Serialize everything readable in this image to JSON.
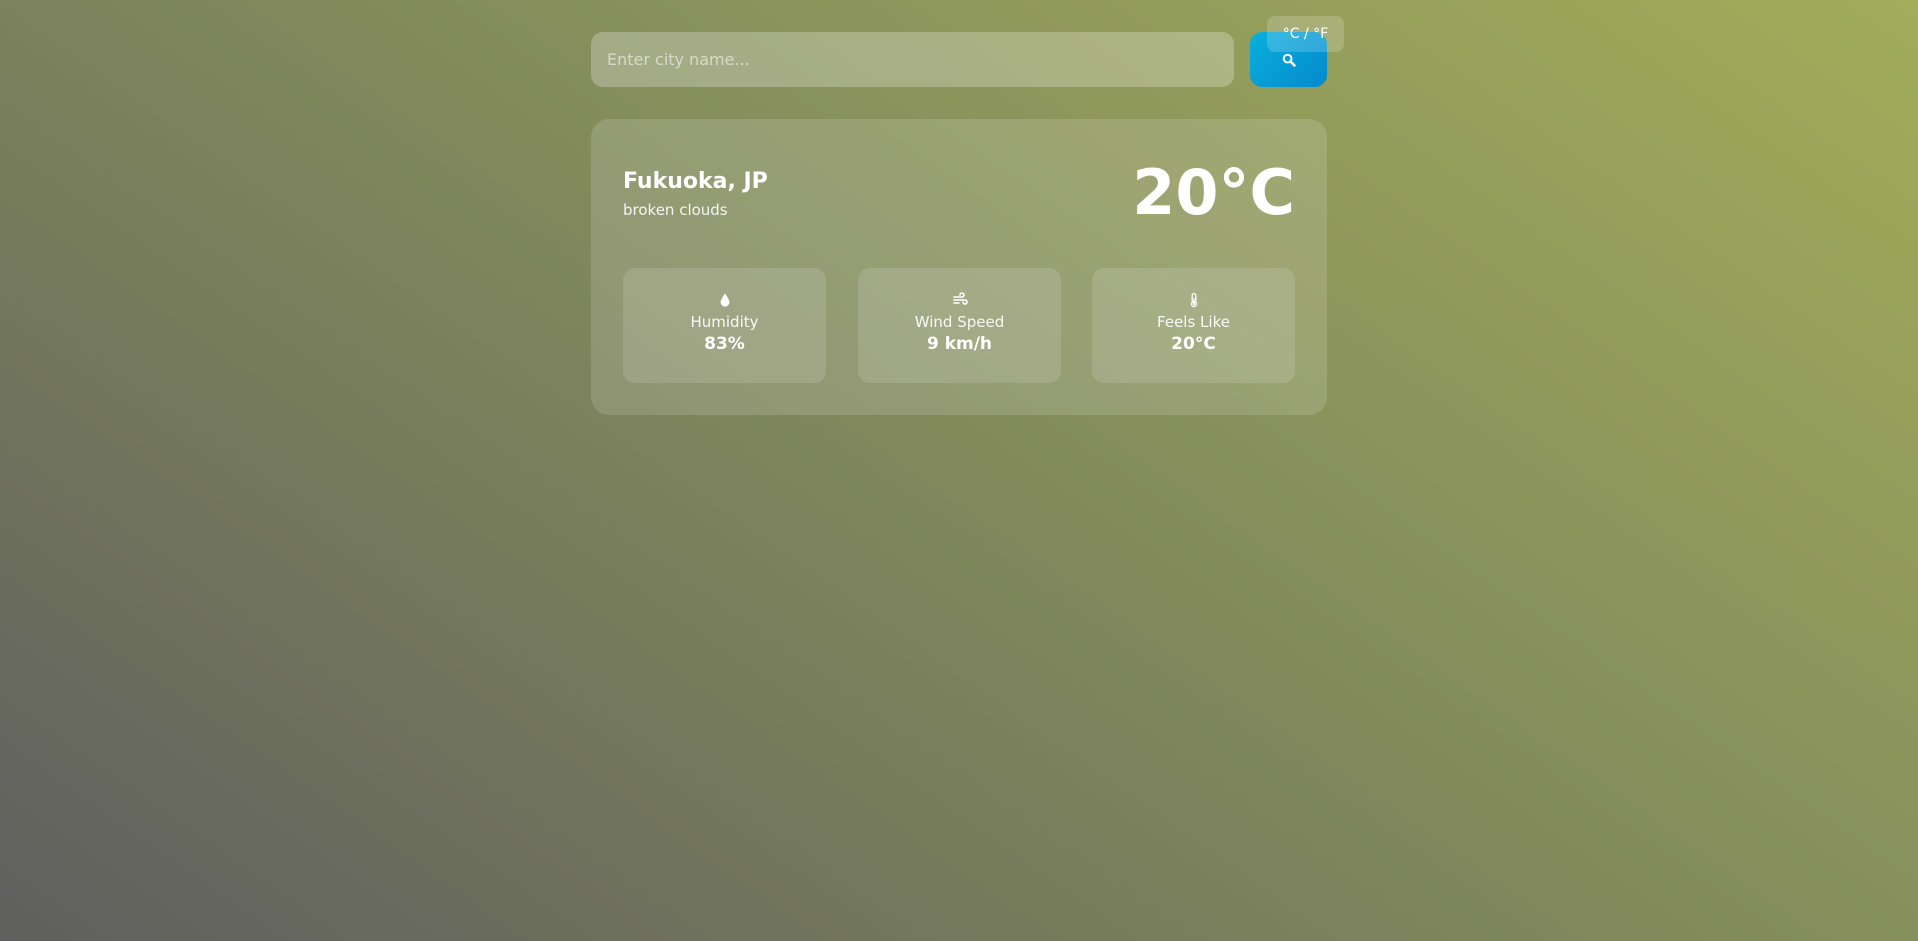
{
  "search": {
    "placeholder": "Enter city name...",
    "value": "",
    "button_icon": "search-icon"
  },
  "unit_toggle": {
    "label": "°C / °F"
  },
  "weather": {
    "city": "Fukuoka, JP",
    "condition": "broken clouds",
    "temperature": "20°C"
  },
  "stats": [
    {
      "icon": "water-drop-icon",
      "label": "Humidity",
      "value": "83%"
    },
    {
      "icon": "wind-icon",
      "label": "Wind Speed",
      "value": "9 km/h"
    },
    {
      "icon": "thermometer-icon",
      "label": "Feels Like",
      "value": "20°C"
    }
  ],
  "colors": {
    "search_button_start": "#0ab0dd",
    "search_button_end": "#0489cc",
    "background_start": "#5f5f5f",
    "background_end": "#a2ad5a"
  }
}
